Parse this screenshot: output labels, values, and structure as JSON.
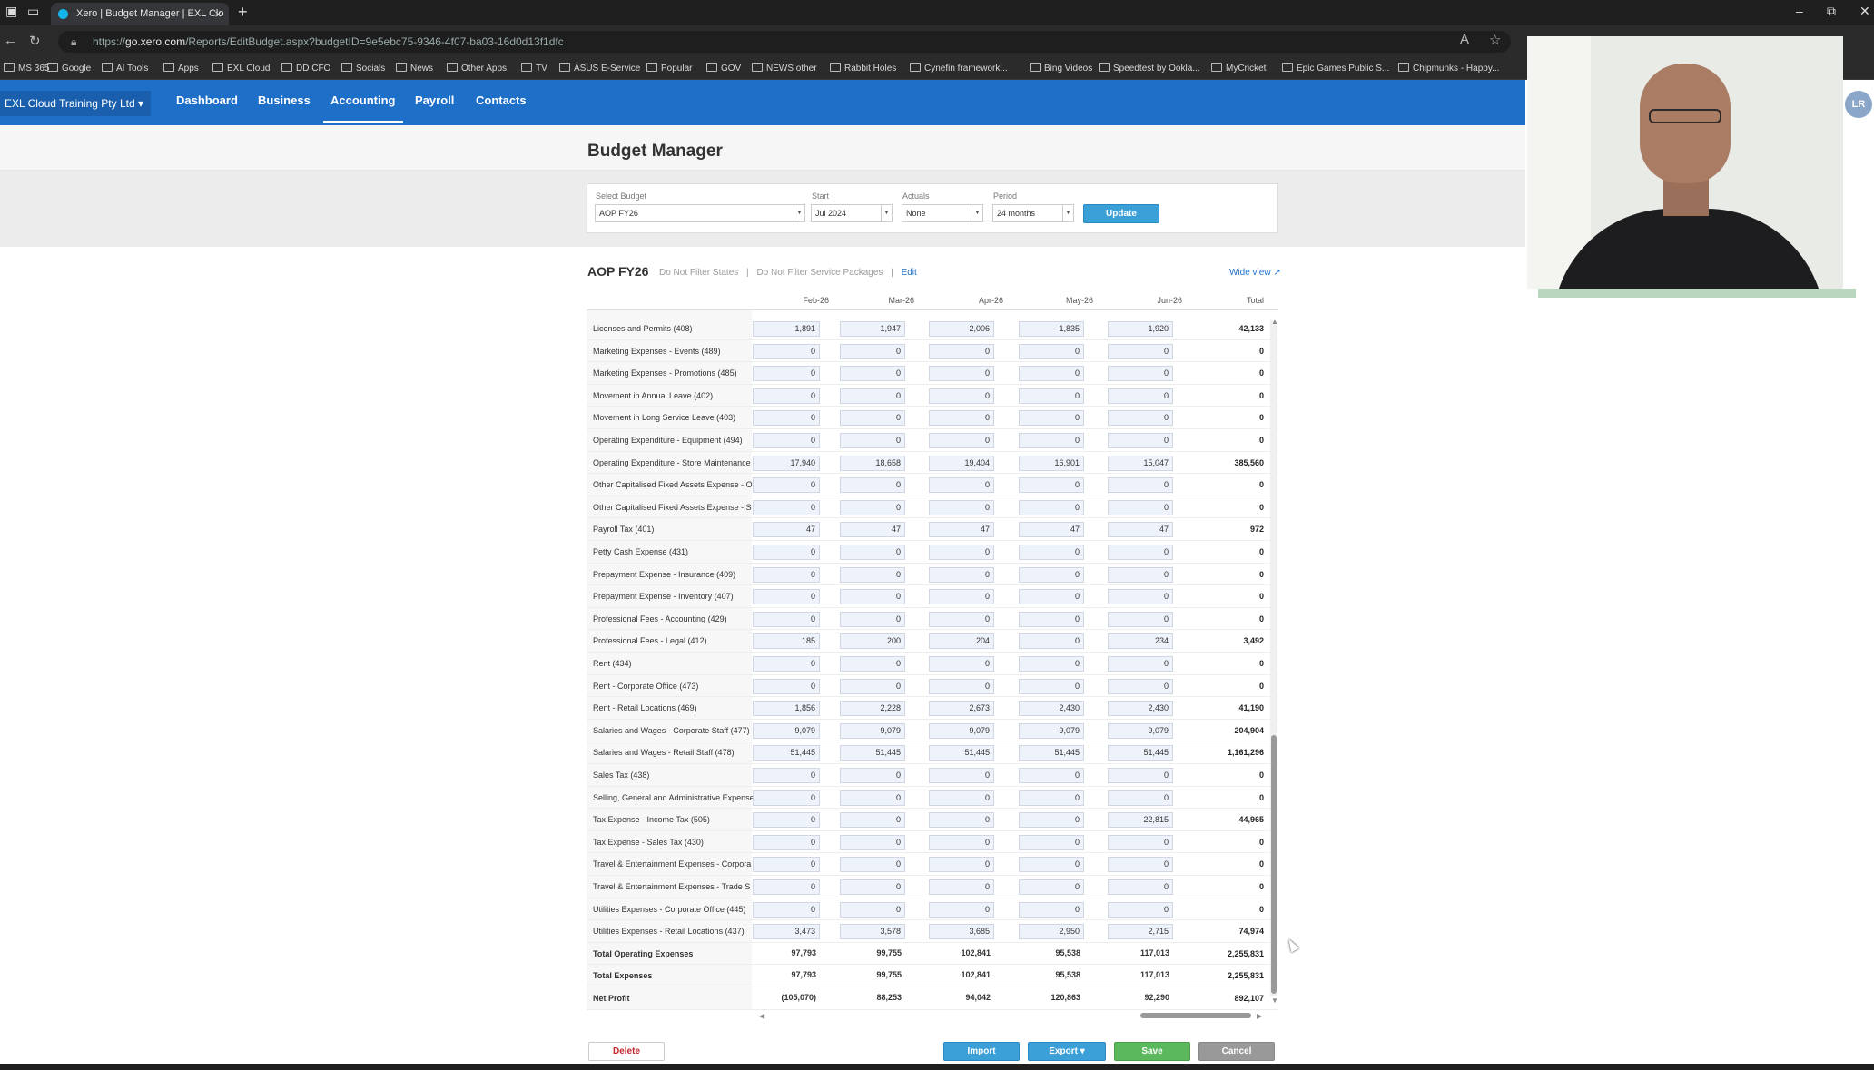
{
  "browser": {
    "tab_title": "Xero | Budget Manager | EXL Clo",
    "url_prefix": "https://",
    "url_host": "go.xero.com",
    "url_path": "/Reports/EditBudget.aspx?budgetID=9e5ebc75-9346-4f07-ba03-16d0d13f1dfc",
    "bookmarks": [
      "MS 365",
      "Google",
      "AI Tools",
      "Apps",
      "EXL Cloud",
      "DD CFO",
      "Socials",
      "News",
      "Other Apps",
      "TV",
      "ASUS E-Service",
      "Popular",
      "GOV",
      "NEWS other",
      "Rabbit Holes",
      "Cynefin framework...",
      "Bing Videos",
      "Speedtest by Ookla...",
      "MyCricket",
      "Epic Games Public S...",
      "Chipmunks - Happy..."
    ]
  },
  "xero_nav": {
    "org": "EXL Cloud Training Pty Ltd ▾",
    "links": [
      "Dashboard",
      "Business",
      "Accounting",
      "Payroll",
      "Contacts"
    ],
    "active": "Accounting",
    "avatar": "LR"
  },
  "page": {
    "title": "Budget Manager"
  },
  "filters": {
    "select_budget_label": "Select Budget",
    "select_budget_value": "AOP FY26",
    "start_label": "Start",
    "start_value": "Jul 2024",
    "actuals_label": "Actuals",
    "actuals_value": "None",
    "period_label": "Period",
    "period_value": "24 months",
    "update_label": "Update"
  },
  "budget": {
    "name": "AOP FY26",
    "filter_1": "Do Not Filter  States",
    "separator": "|",
    "filter_2": "Do Not Filter  Service Packages",
    "edit": "Edit",
    "wide_view": "Wide view ↗"
  },
  "columns": [
    "Feb-26",
    "Mar-26",
    "Apr-26",
    "May-26",
    "Jun-26",
    "Total"
  ],
  "rows": [
    {
      "label": "Licenses and Permits (408)",
      "v": [
        "1,891",
        "1,947",
        "2,006",
        "1,835",
        "1,920"
      ],
      "total": "42,133"
    },
    {
      "label": "Marketing Expenses - Events (489)",
      "v": [
        "0",
        "0",
        "0",
        "0",
        "0"
      ],
      "total": "0"
    },
    {
      "label": "Marketing Expenses - Promotions (485)",
      "v": [
        "0",
        "0",
        "0",
        "0",
        "0"
      ],
      "total": "0"
    },
    {
      "label": "Movement in Annual Leave (402)",
      "v": [
        "0",
        "0",
        "0",
        "0",
        "0"
      ],
      "total": "0"
    },
    {
      "label": "Movement in Long Service Leave (403)",
      "v": [
        "0",
        "0",
        "0",
        "0",
        "0"
      ],
      "total": "0"
    },
    {
      "label": "Operating Expenditure - Equipment (494)",
      "v": [
        "0",
        "0",
        "0",
        "0",
        "0"
      ],
      "total": "0"
    },
    {
      "label": "Operating Expenditure - Store Maintenance",
      "v": [
        "17,940",
        "18,658",
        "19,404",
        "16,901",
        "15,047"
      ],
      "total": "385,560"
    },
    {
      "label": "Other Capitalised Fixed Assets Expense - O",
      "v": [
        "0",
        "0",
        "0",
        "0",
        "0"
      ],
      "total": "0"
    },
    {
      "label": "Other Capitalised Fixed Assets Expense - S",
      "v": [
        "0",
        "0",
        "0",
        "0",
        "0"
      ],
      "total": "0"
    },
    {
      "label": "Payroll Tax (401)",
      "v": [
        "47",
        "47",
        "47",
        "47",
        "47"
      ],
      "total": "972"
    },
    {
      "label": "Petty Cash Expense (431)",
      "v": [
        "0",
        "0",
        "0",
        "0",
        "0"
      ],
      "total": "0"
    },
    {
      "label": "Prepayment Expense - Insurance (409)",
      "v": [
        "0",
        "0",
        "0",
        "0",
        "0"
      ],
      "total": "0"
    },
    {
      "label": "Prepayment Expense - Inventory (407)",
      "v": [
        "0",
        "0",
        "0",
        "0",
        "0"
      ],
      "total": "0"
    },
    {
      "label": "Professional Fees - Accounting (429)",
      "v": [
        "0",
        "0",
        "0",
        "0",
        "0"
      ],
      "total": "0"
    },
    {
      "label": "Professional Fees - Legal (412)",
      "v": [
        "185",
        "200",
        "204",
        "0",
        "234"
      ],
      "total": "3,492"
    },
    {
      "label": "Rent (434)",
      "v": [
        "0",
        "0",
        "0",
        "0",
        "0"
      ],
      "total": "0"
    },
    {
      "label": "Rent - Corporate Office (473)",
      "v": [
        "0",
        "0",
        "0",
        "0",
        "0"
      ],
      "total": "0"
    },
    {
      "label": "Rent - Retail Locations (469)",
      "v": [
        "1,856",
        "2,228",
        "2,673",
        "2,430",
        "2,430"
      ],
      "total": "41,190"
    },
    {
      "label": "Salaries and Wages - Corporate Staff (477)",
      "v": [
        "9,079",
        "9,079",
        "9,079",
        "9,079",
        "9,079"
      ],
      "total": "204,904"
    },
    {
      "label": "Salaries and Wages - Retail Staff (478)",
      "v": [
        "51,445",
        "51,445",
        "51,445",
        "51,445",
        "51,445"
      ],
      "total": "1,161,296"
    },
    {
      "label": "Sales Tax (438)",
      "v": [
        "0",
        "0",
        "0",
        "0",
        "0"
      ],
      "total": "0"
    },
    {
      "label": "Selling, General and Administrative Expense",
      "v": [
        "0",
        "0",
        "0",
        "0",
        "0"
      ],
      "total": "0"
    },
    {
      "label": "Tax Expense - Income Tax (505)",
      "v": [
        "0",
        "0",
        "0",
        "0",
        "22,815"
      ],
      "total": "44,965"
    },
    {
      "label": "Tax Expense - Sales Tax (430)",
      "v": [
        "0",
        "0",
        "0",
        "0",
        "0"
      ],
      "total": "0"
    },
    {
      "label": "Travel & Entertainment Expenses - Corpora",
      "v": [
        "0",
        "0",
        "0",
        "0",
        "0"
      ],
      "total": "0"
    },
    {
      "label": "Travel & Entertainment Expenses - Trade S",
      "v": [
        "0",
        "0",
        "0",
        "0",
        "0"
      ],
      "total": "0"
    },
    {
      "label": "Utilities Expenses - Corporate Office (445)",
      "v": [
        "0",
        "0",
        "0",
        "0",
        "0"
      ],
      "total": "0"
    },
    {
      "label": "Utilities Expenses - Retail Locations (437)",
      "v": [
        "3,473",
        "3,578",
        "3,685",
        "2,950",
        "2,715"
      ],
      "total": "74,974"
    },
    {
      "label": "Total Operating Expenses",
      "v": [
        "97,793",
        "99,755",
        "102,841",
        "95,538",
        "117,013"
      ],
      "total": "2,255,831",
      "bold": true
    },
    {
      "label": "Total Expenses",
      "v": [
        "97,793",
        "99,755",
        "102,841",
        "95,538",
        "117,013"
      ],
      "total": "2,255,831",
      "bold": true
    },
    {
      "label": "Net Profit",
      "v": [
        "(105,070)",
        "88,253",
        "94,042",
        "120,863",
        "92,290"
      ],
      "total": "892,107",
      "bold": true
    }
  ],
  "buttons": {
    "delete": "Delete",
    "import": "Import",
    "export": "Export ▾",
    "save": "Save",
    "cancel": "Cancel"
  }
}
